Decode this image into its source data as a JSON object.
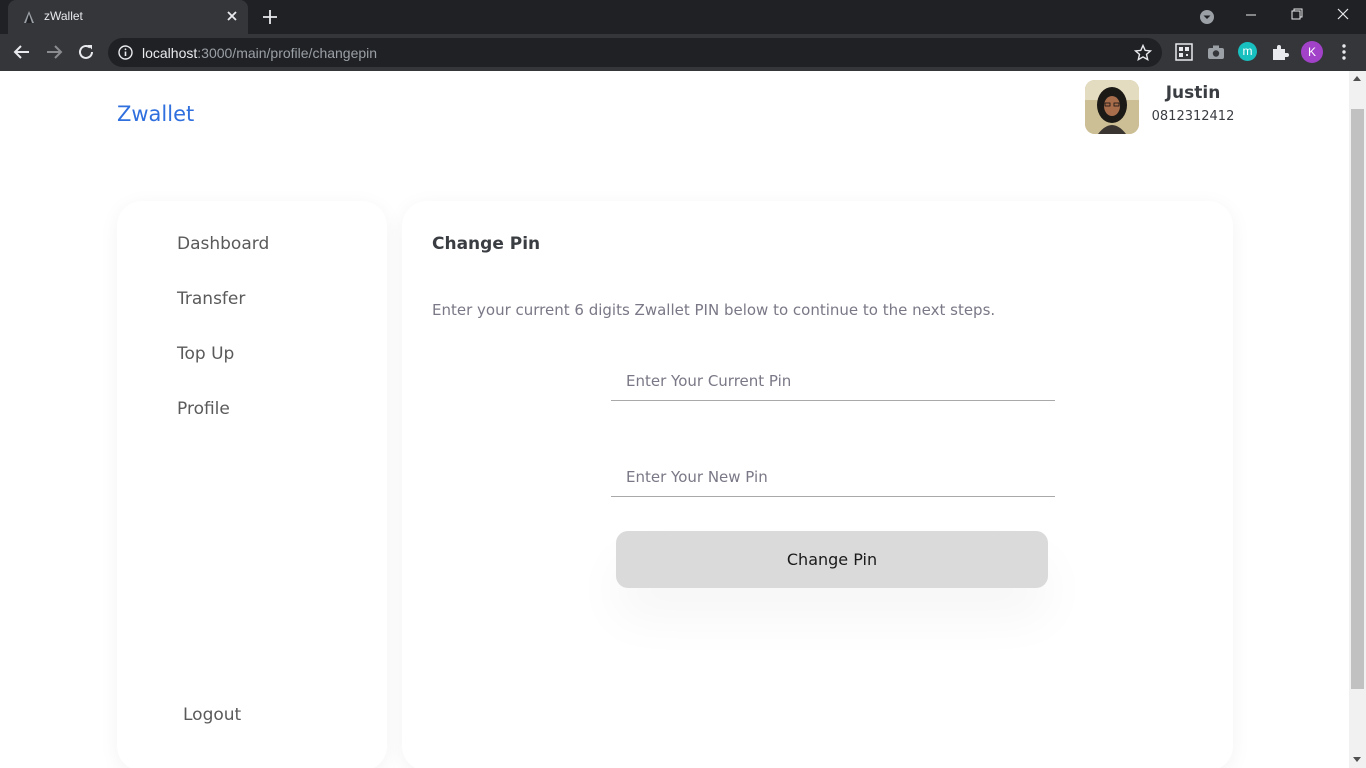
{
  "browser": {
    "tab_title": "zWallet",
    "url_host": "localhost",
    "url_path": ":3000/main/profile/changepin",
    "profile_initial": "K"
  },
  "header": {
    "brand": "Zwallet",
    "user_name": "Justin",
    "user_phone": "0812312412"
  },
  "sidebar": {
    "items": [
      {
        "label": "Dashboard"
      },
      {
        "label": "Transfer"
      },
      {
        "label": "Top Up"
      },
      {
        "label": "Profile"
      }
    ],
    "logout_label": "Logout"
  },
  "main": {
    "title": "Change Pin",
    "description": "Enter your current 6 digits Zwallet PIN below to continue to the next steps.",
    "current_pin_placeholder": "Enter Your Current Pin",
    "new_pin_placeholder": "Enter Your New Pin",
    "submit_label": "Change Pin"
  },
  "colors": {
    "brand": "#2f6fde",
    "button": "#dadada"
  }
}
